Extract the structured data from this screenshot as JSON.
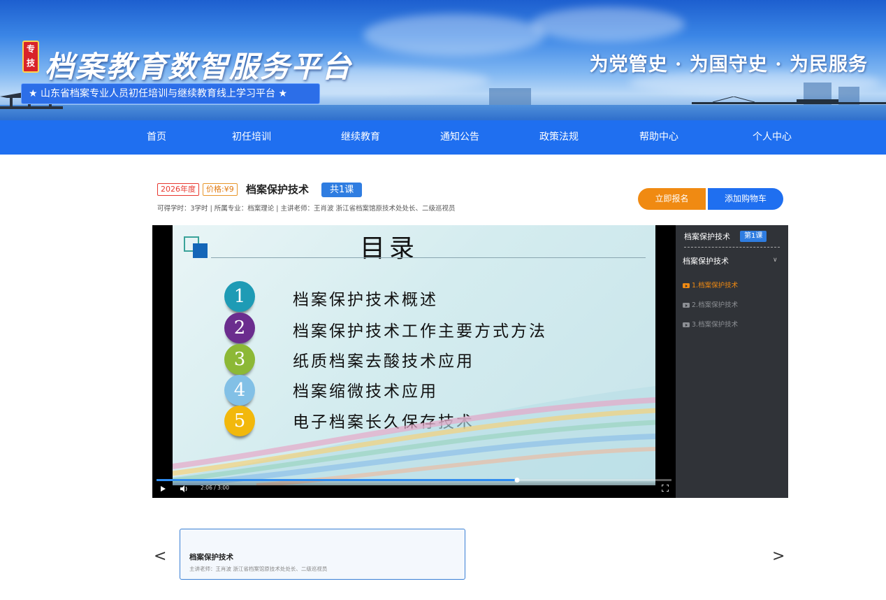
{
  "banner": {
    "badge": "专技",
    "title": "档案教育数智服务平台",
    "subtitle": "★ 山东省档案专业人员初任培训与继续教育线上学习平台 ★",
    "slogan": "为党管史 · 为国守史 · 为民服务"
  },
  "nav": {
    "items": [
      {
        "label": "首页"
      },
      {
        "label": "初任培训"
      },
      {
        "label": "继续教育"
      },
      {
        "label": "通知公告"
      },
      {
        "label": "政策法规"
      },
      {
        "label": "帮助中心"
      },
      {
        "label": "个人中心"
      }
    ]
  },
  "course": {
    "year_tag": "2026年度",
    "price_tag": "价格:¥9",
    "title": "档案保护技术",
    "count_badge": "共1课",
    "meta": "可得学时：3学时 | 所属专业：档案理论 | 主讲老师：王肖波 浙江省档案馆原技术处处长、二级巡视员",
    "enroll_label": "立即报名",
    "cart_label": "添加购物车"
  },
  "slide": {
    "title": "目录",
    "items": [
      {
        "num": "1",
        "text": "档案保护技术概述",
        "color": "#1e9bb5"
      },
      {
        "num": "2",
        "text": "档案保护技术工作主要方式方法",
        "color": "#6b2d8e"
      },
      {
        "num": "3",
        "text": "纸质档案去酸技术应用",
        "color": "#8cb836"
      },
      {
        "num": "4",
        "text": "档案缩微技术应用",
        "color": "#82c0e6"
      },
      {
        "num": "5",
        "text": "电子档案长久保存技术",
        "color": "#f2b80c"
      }
    ]
  },
  "player": {
    "time": "2:06 / 3:00",
    "progress": 0.7
  },
  "sidebar": {
    "course_title": "档案保护技术",
    "lesson_badge": "第1课",
    "section_title": "档案保护技术",
    "items": [
      {
        "label": "1.档案保护技术",
        "active": true
      },
      {
        "label": "2.档案保护技术",
        "active": false
      },
      {
        "label": "3.档案保护技术",
        "active": false
      }
    ]
  },
  "carousel": {
    "prev": "<",
    "next": ">",
    "card_title": "档案保护技术",
    "card_sub": "主讲老师：王肖波 浙江省档案馆原技术处处长、二级巡视员"
  },
  "colors": {
    "nav_bg": "#1f6ff0",
    "accent_orange": "#f08a12",
    "badge_blue": "#2f7de1",
    "sidebar_bg": "#303338"
  }
}
